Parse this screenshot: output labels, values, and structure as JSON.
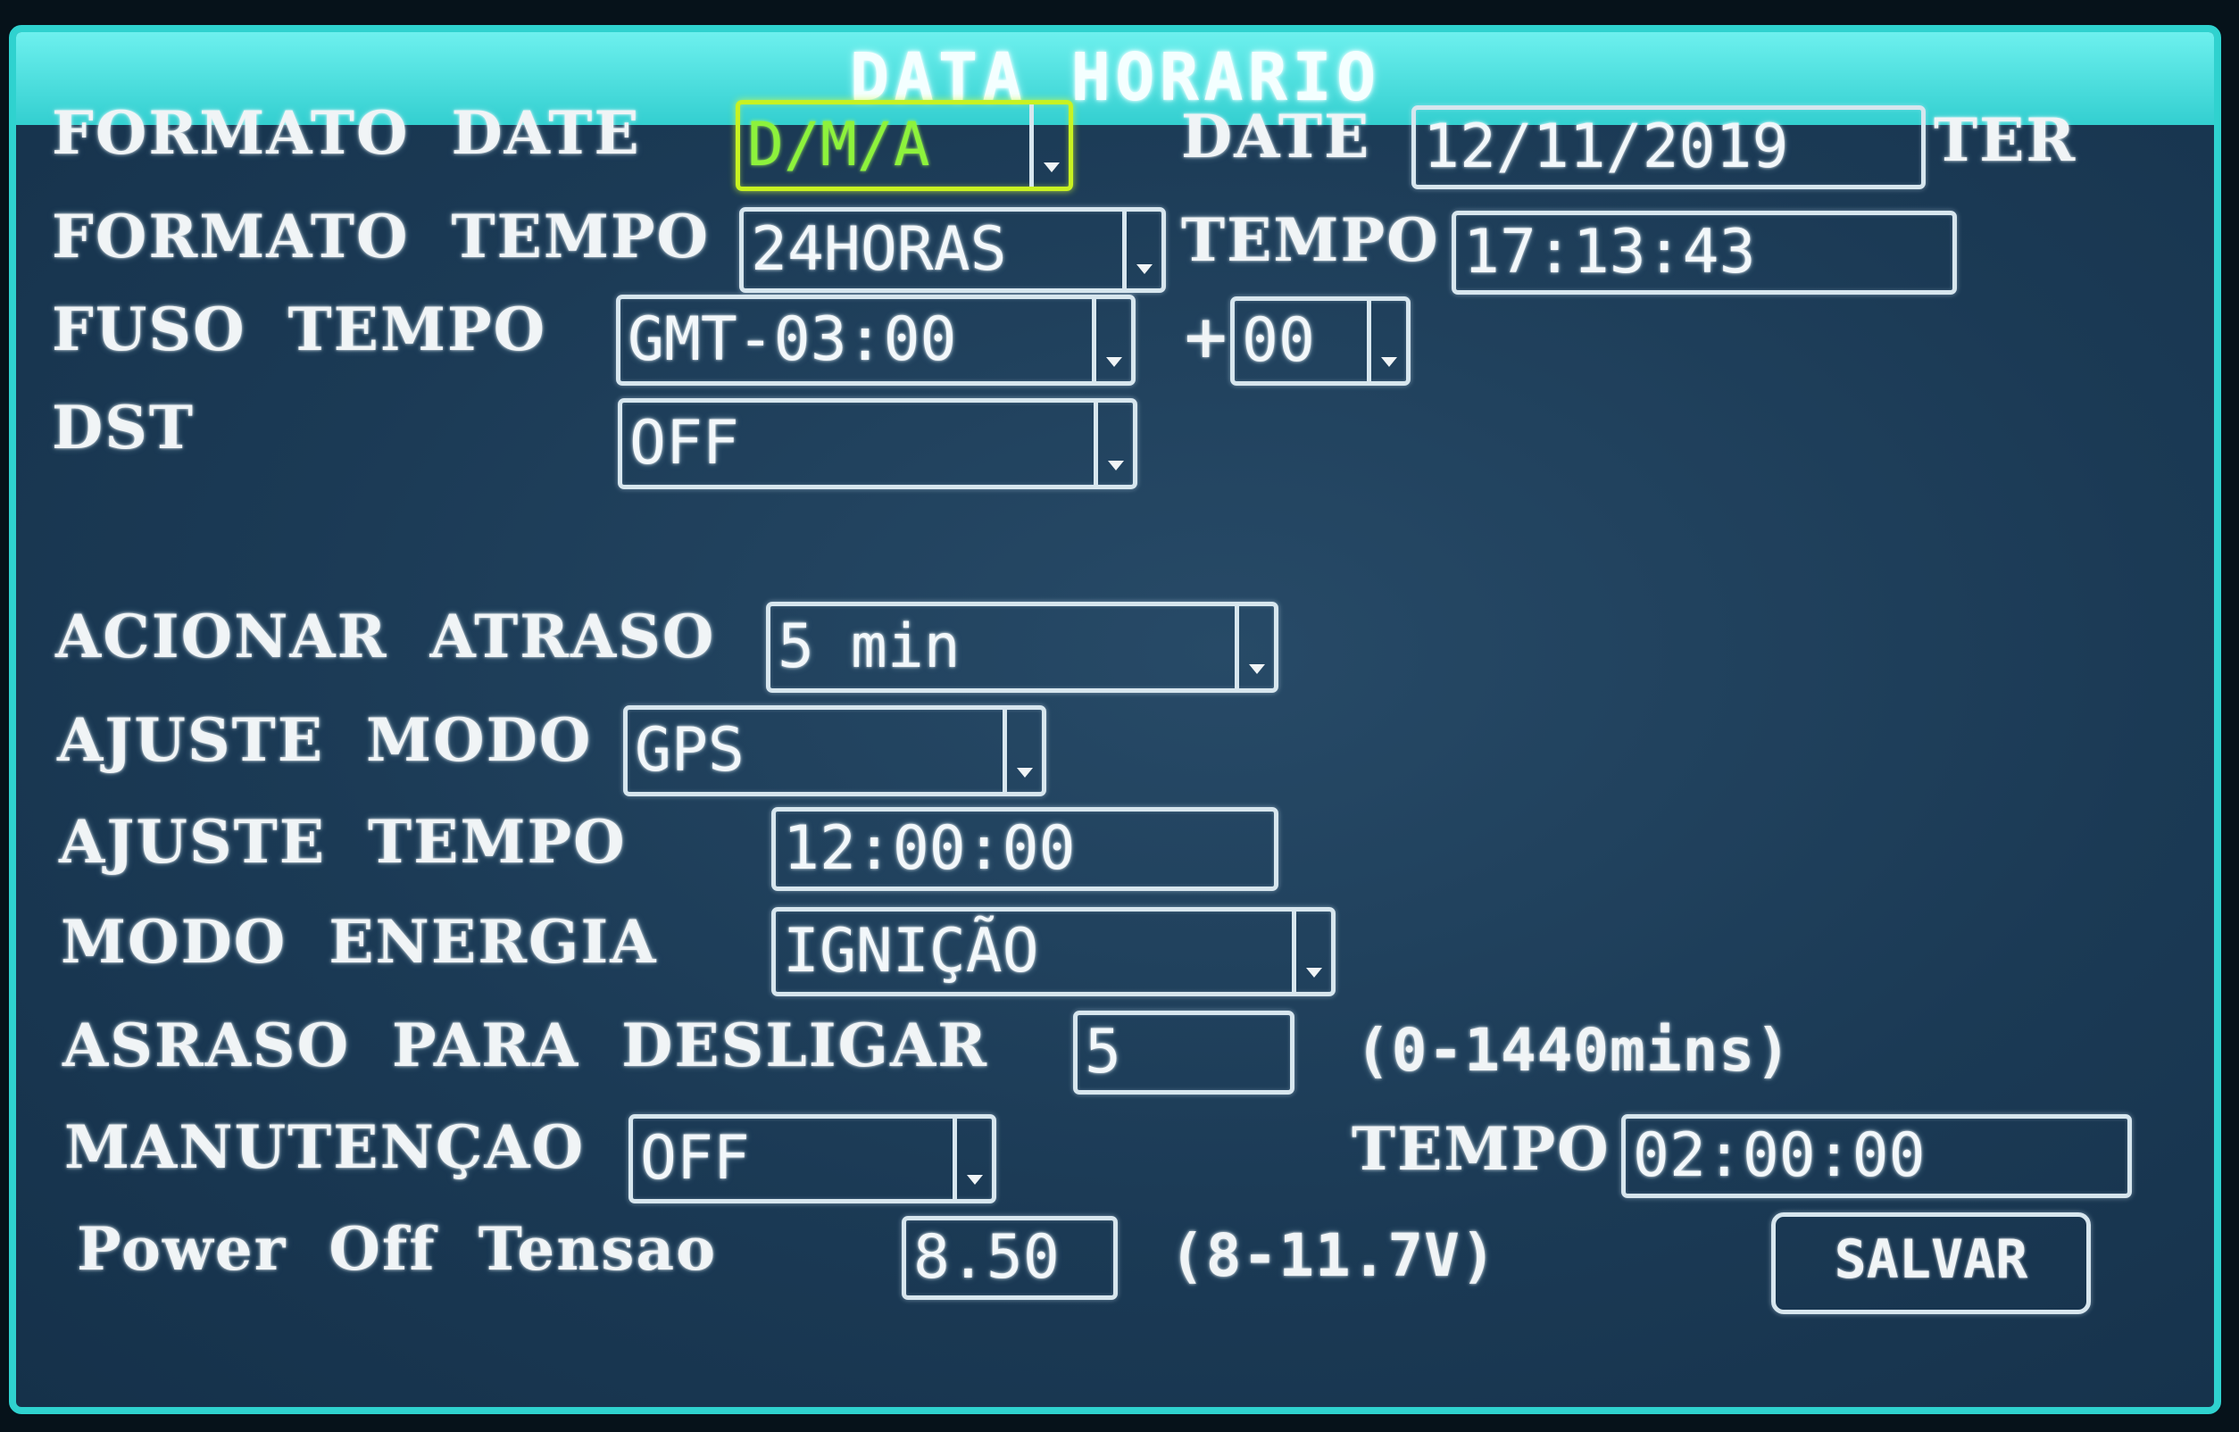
{
  "title": "DATA HORARIO",
  "colors": {
    "frame": "#2fd2cf",
    "title_bar": "#33cfd0",
    "background": "#1b3a55",
    "text": "#f0f4f6",
    "highlight_border": "#c8f222",
    "highlight_text": "#8df23c"
  },
  "labels": {
    "formato_date": "FORMATO DATE",
    "date": "DATE",
    "formato_tempo": "FORMATO TEMPO",
    "tempo": "TEMPO",
    "fuso_tempo": "FUSO TEMPO",
    "offset_prefix": "+",
    "dst": "DST",
    "acionar_atraso": "ACIONAR ATRASO",
    "ajuste_modo": "AJUSTE MODO",
    "ajuste_tempo": "AJUSTE TEMPO",
    "modo_energia": "MODO ENERGIA",
    "asraso_desligar": "ASRASO PARA DESLIGAR",
    "manutencao": "MANUTENÇAO",
    "manut_tempo": "TEMPO",
    "power_off": "Power Off Tensao"
  },
  "fields": {
    "formato_date": "D/M/A",
    "date": "12/11/2019",
    "weekday": "TER",
    "formato_tempo": "24HORAS",
    "tempo": "17:13:43",
    "fuso_tempo": "GMT-03:00",
    "fuso_offset": "00",
    "dst": "OFF",
    "acionar_atraso": "5 min",
    "ajuste_modo": "GPS",
    "ajuste_tempo": "12:00:00",
    "modo_energia": "IGNIÇÃO",
    "asraso_desligar": "5",
    "asraso_range": "(0-1440mins)",
    "manutencao": "OFF",
    "manut_tempo": "02:00:00",
    "power_off": "8.50",
    "power_off_range": "(8-11.7V)"
  },
  "buttons": {
    "salvar": "SALVAR"
  },
  "icons": {
    "dropdown": "chevron-down-icon"
  }
}
